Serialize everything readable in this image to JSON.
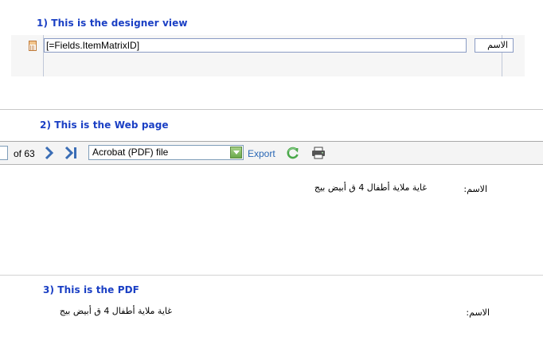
{
  "sections": {
    "designer_heading": "1) This is the designer view",
    "web_heading": "2) This is the Web page",
    "pdf_heading": "3) This is the PDF"
  },
  "designer": {
    "field_expression": "[=Fields.ItemMatrixID]",
    "label_text": "الاسم",
    "icon": "calculator-icon"
  },
  "toolbar": {
    "page_of": "of 63",
    "next_icon": "chevron-right-icon",
    "last_icon": "last-page-icon",
    "export_format": "Acrobat (PDF) file",
    "export_label": "Export",
    "refresh_icon": "refresh-icon",
    "print_icon": "printer-icon",
    "colors": {
      "nav_blue": "#3a6db5",
      "export_link": "#2a67b5",
      "refresh_green": "#4aa84a"
    }
  },
  "web_page": {
    "label": "الاسم:",
    "value": "غاية ملاية أطفال 4 ق أبيض بيج"
  },
  "pdf": {
    "label": "الاسم:",
    "value": "غاية ملاية أطفال 4 ق أبيض بيج"
  },
  "colors": {
    "heading_blue": "#1a3fc4"
  }
}
